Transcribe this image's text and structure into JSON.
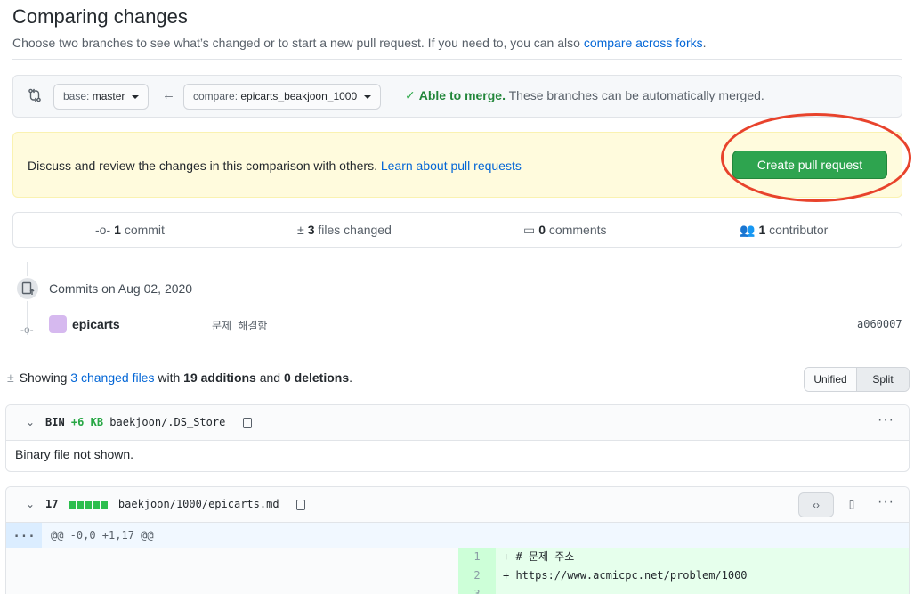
{
  "header": {
    "title": "Comparing changes",
    "subtitle": "Choose two branches to see what’s changed or to start a new pull request. If you need to, you can also",
    "subtitle_link": "compare across forks",
    "subtitle_end": "."
  },
  "range": {
    "base_label": "base:",
    "base_value": "master",
    "compare_label": "compare:",
    "compare_value": "epicarts_beakjoon_1000",
    "merge_status": "Able to merge.",
    "merge_detail": "These branches can be automatically merged."
  },
  "discuss": {
    "text": "Discuss and review the changes in this comparison with others.",
    "link": "Learn about pull requests",
    "button": "Create pull request"
  },
  "summary": {
    "commits_count": "1",
    "commits_label": "commit",
    "files_count": "3",
    "files_label": "files changed",
    "comments_count": "0",
    "comments_label": "comments",
    "contributors_count": "1",
    "contributors_label": "contributor"
  },
  "commits": {
    "date_label": "Commits on Aug 02, 2020",
    "author": "epicarts",
    "message": "문제 해결함",
    "sha": "a060007"
  },
  "showing": {
    "prefix": "Showing",
    "files_link": "3 changed files",
    "with": "with",
    "additions": "19 additions",
    "and": "and",
    "deletions": "0 deletions",
    "end": "."
  },
  "view_toggle": {
    "unified": "Unified",
    "split": "Split"
  },
  "files": [
    {
      "kind": "BIN",
      "size": "+6 KB",
      "path": "baekjoon/.DS_Store",
      "note": "Binary file not shown."
    },
    {
      "count": "17",
      "path": "baekjoon/1000/epicarts.md",
      "hunk_expand": "...",
      "hunk_header": "@@ -0,0 +1,17 @@",
      "lines": [
        {
          "num": "1",
          "text": "+ # 문제 주소"
        },
        {
          "num": "2",
          "text": "+ https://www.acmicpc.net/problem/1000"
        },
        {
          "num": "3",
          "text": ""
        }
      ]
    }
  ],
  "colors": {
    "accent": "#0366d6",
    "success": "#2ea44f",
    "annotation": "#e8432c"
  }
}
